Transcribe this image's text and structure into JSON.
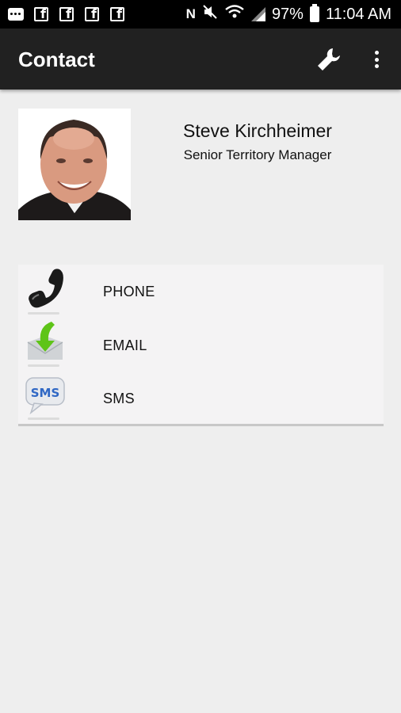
{
  "status_bar": {
    "left_icons": [
      "messenger-icon",
      "facebook-icon",
      "facebook-icon",
      "facebook-icon",
      "facebook-icon"
    ],
    "right_icons": [
      "nfc-icon",
      "mute-icon",
      "wifi-icon",
      "signal-icon",
      "battery-icon"
    ],
    "battery": "97%",
    "time": "11:04 AM"
  },
  "app_bar": {
    "title": "Contact",
    "actions": [
      "wrench-icon",
      "more-vert-icon"
    ]
  },
  "profile": {
    "name": "Steve Kirchheimer",
    "job_title": "Senior Territory Manager"
  },
  "actions": [
    {
      "label": "PHONE",
      "icon": "phone-icon"
    },
    {
      "label": "EMAIL",
      "icon": "email-icon"
    },
    {
      "label": "SMS",
      "icon": "sms-icon",
      "icon_text": "SMS"
    }
  ],
  "colors": {
    "status_bar": "#000000",
    "app_bar": "#212121",
    "background": "#eeeeee",
    "list_background": "#f4f3f4",
    "email_arrow": "#5ec418",
    "sms_bubble": "#2f67c4"
  }
}
